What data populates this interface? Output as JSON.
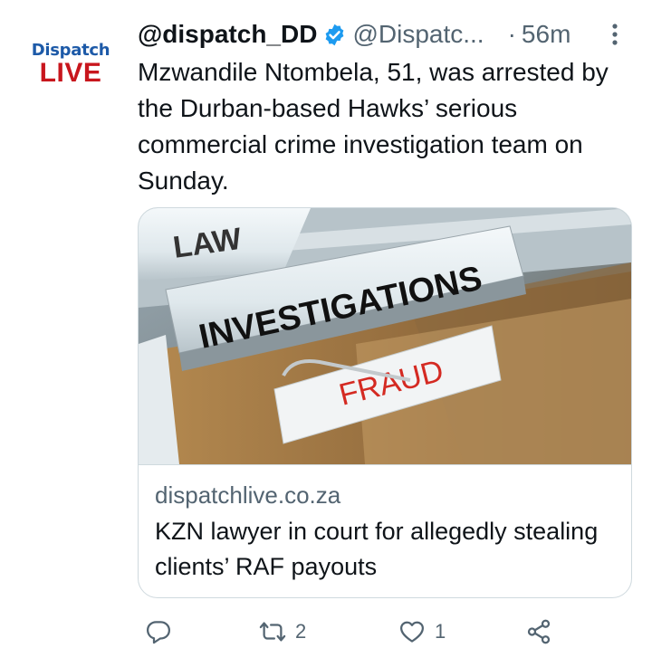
{
  "avatar": {
    "brand_line1": "Dispatch",
    "brand_line2": "LIVE"
  },
  "header": {
    "display_name": "@dispatch_DD",
    "handle": "@Dispatc...",
    "separator": "·",
    "time": "56m"
  },
  "tweet": {
    "text": "Mzwandile Ntombela, 51, was arrested by the Durban-based Hawks’ serious commercial crime investigation team on Sunday."
  },
  "card": {
    "image_words": {
      "tab1": "LAW",
      "tab2": "INVESTIGATIONS",
      "tab3": "FRAUD"
    },
    "domain": "dispatchlive.co.za",
    "title": "KZN lawyer in court for allegedly stealing clients’ RAF payouts"
  },
  "actions": {
    "reply_icon": "reply-icon",
    "retweet_icon": "retweet-icon",
    "retweet_count": "2",
    "like_icon": "heart-icon",
    "like_count": "1",
    "share_icon": "share-icon"
  },
  "colors": {
    "brand_blue": "#1d5aa8",
    "brand_red": "#c8161d",
    "verified_blue": "#1d9bf0",
    "muted": "#536471"
  }
}
